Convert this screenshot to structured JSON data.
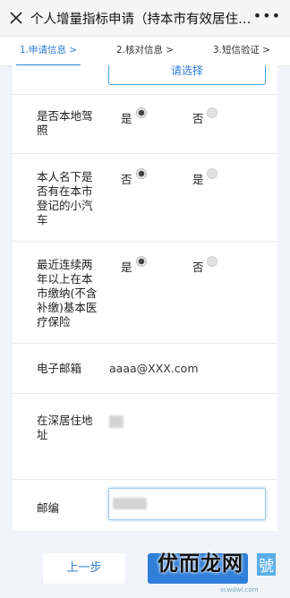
{
  "header": {
    "title": "个人增量指标申请（持本市有效居住证的…",
    "more_label": "•••"
  },
  "steps": [
    {
      "label": "1.申请信息 >"
    },
    {
      "label": "2.核对信息 >"
    },
    {
      "label": "3.短信验证 >"
    }
  ],
  "cut_button": {
    "label": "请选择"
  },
  "form": {
    "local_license": {
      "label": "是否本地驾照",
      "opt1": "是",
      "opt2": "否",
      "selected": "是"
    },
    "own_car": {
      "label": "本人名下是否有在本市登记的小汽车",
      "opt1": "否",
      "opt2": "是",
      "selected": "否"
    },
    "insurance": {
      "label": "最近连续两年以上在本市缴纳(不含补缴)基本医疗保险",
      "opt1": "是",
      "opt2": "否",
      "selected": "是"
    },
    "email": {
      "label": "电子邮箱",
      "value": "aaaa@XXX.com"
    },
    "address": {
      "label": "在深居住地址"
    },
    "zip": {
      "label": "邮编"
    }
  },
  "footer": {
    "prev_label": "上一步"
  },
  "watermark": {
    "text": "优而龙网",
    "badge": "號",
    "domain": "scwdwl.com"
  },
  "colors": {
    "accent": "#2f7ed8",
    "background": "#f0f3f7"
  }
}
